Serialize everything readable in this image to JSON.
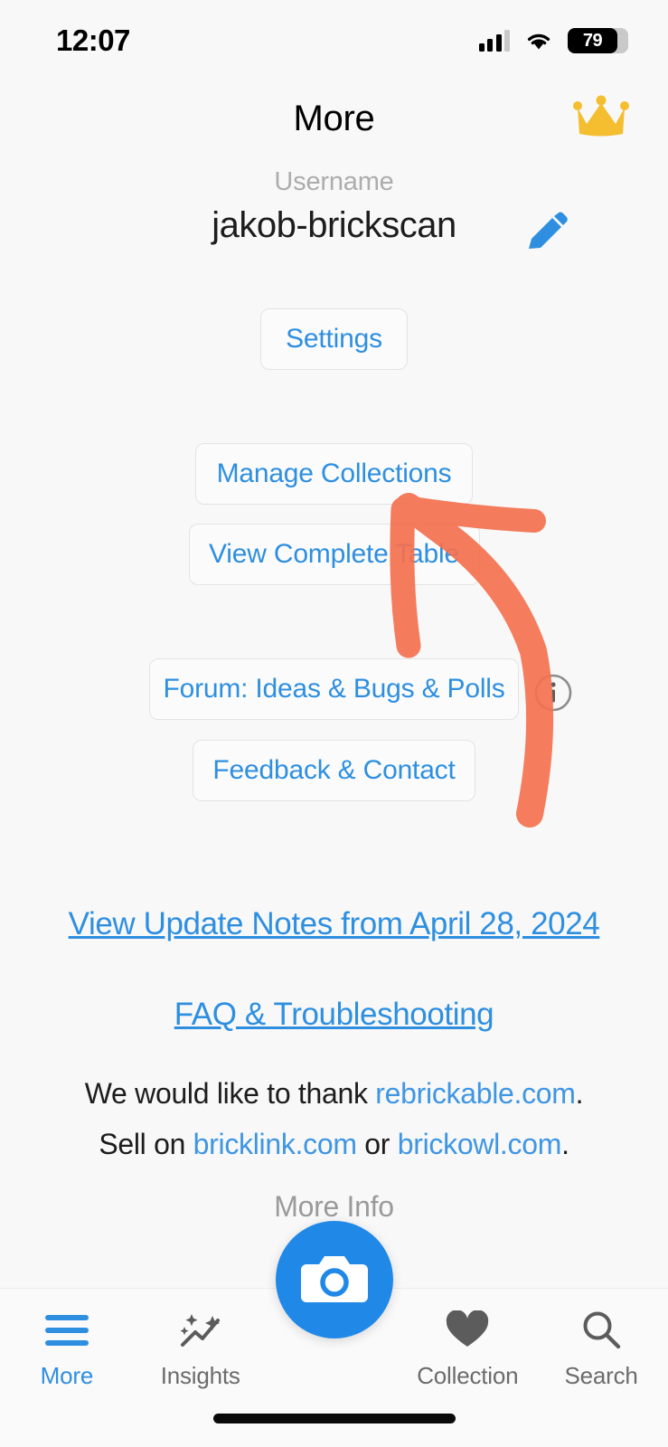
{
  "status_bar": {
    "time": "12:07",
    "battery_percent": "79",
    "cellular_icon": "cellular-signal-icon",
    "wifi_icon": "wifi-icon"
  },
  "header": {
    "title": "More",
    "premium_icon": "crown-icon"
  },
  "profile": {
    "username_label": "Username",
    "username_value": "jakob-brickscan",
    "edit_icon": "pencil-edit-icon"
  },
  "actions": {
    "settings_label": "Settings",
    "manage_collections_label": "Manage Collections",
    "view_complete_table_label": "View Complete Table",
    "forum_label": "Forum: Ideas & Bugs & Polls",
    "forum_info_icon": "info-circle-icon",
    "feedback_label": "Feedback & Contact"
  },
  "links": {
    "update_notes": "View Update Notes from April 28, 2024",
    "faq": "FAQ & Troubleshooting"
  },
  "credits": {
    "thanks_prefix": "We would like to thank ",
    "thanks_link": "rebrickable.com",
    "thanks_suffix": ".",
    "sell_prefix": "Sell on ",
    "sell_link_1": "bricklink.com",
    "sell_middle": " or ",
    "sell_link_2": "brickowl.com",
    "sell_suffix": ".",
    "more_info": "More Info"
  },
  "annotation": {
    "type": "hand-drawn-arrow",
    "color": "#F4714F",
    "points_to": "Manage Collections"
  },
  "tabbar": {
    "items": [
      {
        "label": "More",
        "icon": "hamburger-menu-icon",
        "active": true
      },
      {
        "label": "Insights",
        "icon": "sparkle-chart-icon",
        "active": false
      },
      {
        "label": "Collection",
        "icon": "heart-icon",
        "active": false
      },
      {
        "label": "Search",
        "icon": "magnifier-search-icon",
        "active": false
      }
    ],
    "camera_button_icon": "camera-icon"
  },
  "colors": {
    "accent_blue": "#2e8fe0",
    "fab_blue": "#2089e8",
    "crown_gold": "#F4BE30",
    "annotation_orange": "#F4714F",
    "background": "#f8f8f8"
  }
}
